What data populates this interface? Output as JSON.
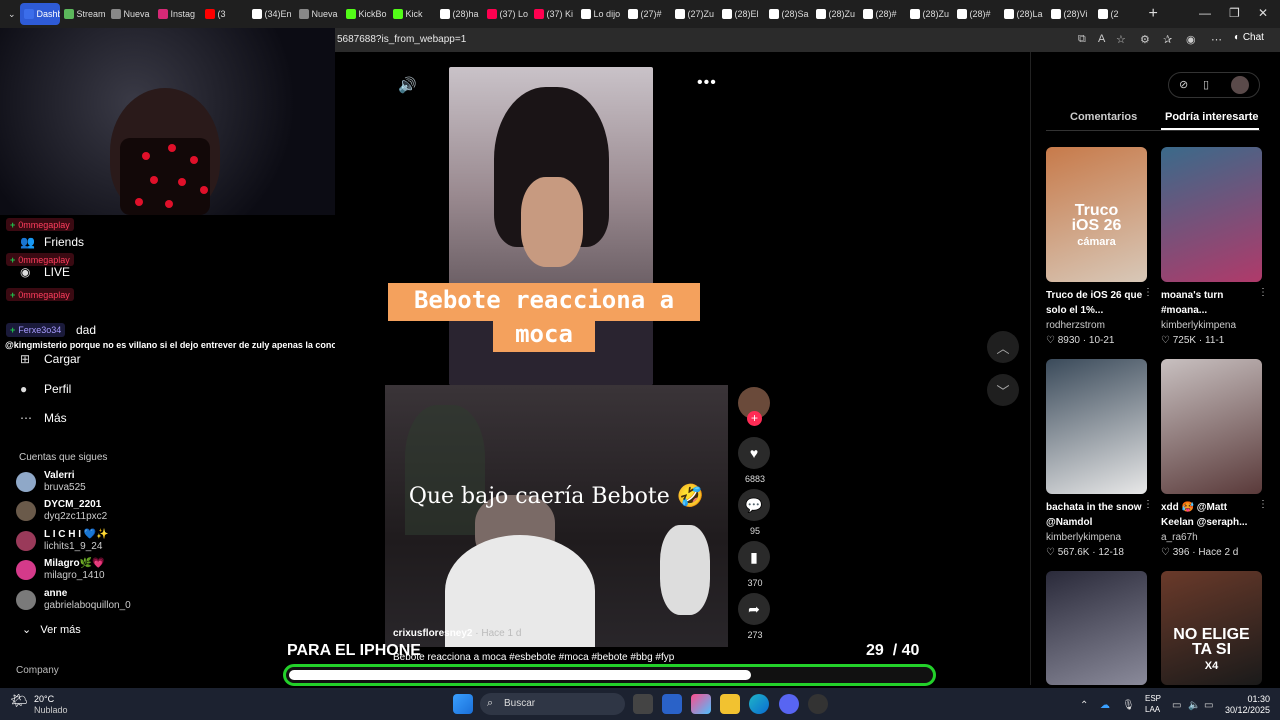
{
  "browser": {
    "tabs": [
      {
        "label": "Dashbo",
        "active": true,
        "color": "#3b6dea"
      },
      {
        "label": "Stream",
        "color": "#5cb85c"
      },
      {
        "label": "Nueva",
        "color": "#888888"
      },
      {
        "label": "Instag",
        "color": "#d62976"
      },
      {
        "label": "(3",
        "color": "#ff0000"
      },
      {
        "label": "(34)En",
        "color": "#ffffff"
      },
      {
        "label": "Nueva",
        "color": "#888888"
      },
      {
        "label": "KickBo",
        "color": "#53fc18"
      },
      {
        "label": "Kick",
        "color": "#53fc18"
      },
      {
        "label": "(28)ha",
        "color": "#ffffff"
      },
      {
        "label": "(37) Lo",
        "color": "#ff0050"
      },
      {
        "label": "(37) Ki",
        "color": "#ff0050"
      },
      {
        "label": "Lo dijo",
        "color": "#ffffff"
      },
      {
        "label": "(27)#",
        "color": "#ffffff"
      },
      {
        "label": "(27)Zu",
        "color": "#ffffff"
      },
      {
        "label": "(28)El",
        "color": "#ffffff"
      },
      {
        "label": "(28)Sa",
        "color": "#ffffff"
      },
      {
        "label": "(28)Zu",
        "color": "#ffffff"
      },
      {
        "label": "(28)#",
        "color": "#ffffff"
      },
      {
        "label": "(28)Zu",
        "color": "#ffffff"
      },
      {
        "label": "(28)#",
        "color": "#ffffff"
      },
      {
        "label": "(28)La",
        "color": "#ffffff"
      },
      {
        "label": "(28)Vi",
        "color": "#ffffff"
      },
      {
        "label": "(2",
        "color": "#ffffff"
      }
    ],
    "url": "5687688?is_from_webapp=1",
    "chat_label": "Chat"
  },
  "sidebar": {
    "items": [
      {
        "label": "Friends",
        "icon": "friends-icon"
      },
      {
        "label": "LIVE",
        "icon": "live-icon"
      },
      {
        "label": "dad",
        "icon": "activity-icon"
      },
      {
        "label": "Cargar",
        "icon": "upload-icon"
      },
      {
        "label": "Perfil",
        "icon": "profile-icon"
      },
      {
        "label": "Más",
        "icon": "more-icon"
      }
    ],
    "following_title": "Cuentas que sigues",
    "accounts": [
      {
        "name": "Valerri",
        "handle": "bruva525",
        "color": "#8fa8c8"
      },
      {
        "name": "DYCM_2201",
        "handle": "dyq2zc11pxc2",
        "color": "#6a5a4a"
      },
      {
        "name": "L I C H I 💙✨",
        "handle": "lichits1_9_24",
        "color": "#9a3a5a"
      },
      {
        "name": "Milagro🌿💗",
        "handle": "milagro_1410",
        "color": "#d43a8a"
      },
      {
        "name": "anne",
        "handle": "gabrielaboquillon_0",
        "color": "#7a7a7a"
      }
    ],
    "see_more": "Ver más",
    "company": "Company"
  },
  "chat_overlay": {
    "badges": [
      "0mmegaplay",
      "0mmegaplay",
      "0mmegaplay"
    ],
    "ferxe": "Ferxe3o34",
    "message": "@kingmisterio porque no es villano si el dejo entrever de zuly apenas la conocio"
  },
  "video": {
    "title_line1": "Bebote reacciona a",
    "title_line2": "moca",
    "overlay_caption": "Que bajo caería Bebote 🤣",
    "author": "crixusfloresney2",
    "author_time": "· Hace 1 d",
    "description": "Bebote reacciona a moca #esbebote #moca #bebote #bbg #fyp",
    "likes": "6883",
    "comments": "95",
    "saves": "370",
    "shares": "273"
  },
  "stream_overlay": {
    "promo": "PARA EL IPHONE",
    "goal_count": "29",
    "goal_total": "/ 40",
    "progress_fraction": 0.72,
    "progress_color": "#23d12a"
  },
  "right_panel": {
    "tabs": [
      "Comentarios",
      "Podría interesarte"
    ],
    "active_tab": 1,
    "cards": [
      {
        "caption": "Truco de iOS 26 que solo el 1%...",
        "user": "rodherzstrom",
        "likes": "8930",
        "date": "10-21",
        "thumb_text_a": "Truco",
        "thumb_text_b": "iOS 26",
        "thumb_text_c": "cámara",
        "c1": "#c77a4a",
        "c2": "#d8c8b8"
      },
      {
        "caption": "moana's turn #moana...",
        "user": "kimberlykimpena",
        "likes": "725K",
        "date": "11-1",
        "c1": "#3a6a8a",
        "c2": "#b03a6a"
      },
      {
        "caption": "bachata in the snow @Namdol",
        "user": "kimberlykimpena",
        "likes": "567.6K",
        "date": "12-18",
        "c1": "#3a4a5a",
        "c2": "#e8e8e8"
      },
      {
        "caption": "xdd 🥵 @Matt Keelan @seraph...",
        "user": "a_ra67h",
        "likes": "396",
        "date": "Hace 2 d",
        "c1": "#c8c0c0",
        "c2": "#5a3a3a"
      },
      {
        "c1": "#2a2a3a",
        "c2": "#8a8a9a"
      },
      {
        "thumb_text_a": "NO ELIGE",
        "thumb_text_b": "TA SI",
        "thumb_text_c": "X4",
        "c1": "#6a3a2a",
        "c2": "#1a1a1a"
      }
    ]
  },
  "taskbar": {
    "weather_temp": "20°C",
    "weather_desc": "Nublado",
    "search_placeholder": "Buscar",
    "lang1": "ESP",
    "lang2": "LAA",
    "time": "01:30",
    "date": "30/12/2025"
  }
}
